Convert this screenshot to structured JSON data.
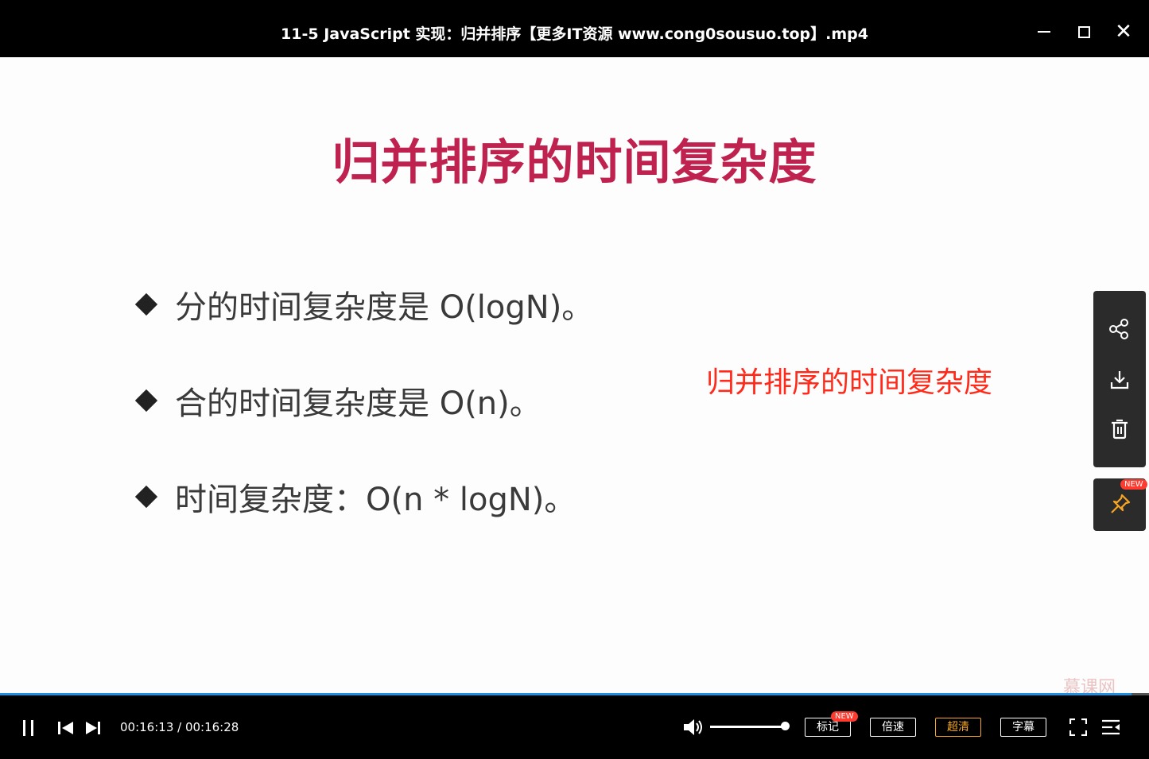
{
  "window": {
    "title": "11-5 JavaScript 实现：归并排序【更多IT资源 www.cong0sousuo.top】.mp4",
    "minimize_icon": "minimize-icon",
    "maximize_icon": "maximize-icon",
    "close_icon": "close-icon",
    "close_glyph": "✕"
  },
  "slide": {
    "title": "归并排序的时间复杂度",
    "bullets": [
      "分的时间复杂度是 O(logN)。",
      "合的时间复杂度是 O(n)。",
      "时间复杂度：O(n * logN)。"
    ]
  },
  "overlay_note": "归并排序的时间复杂度",
  "side_tools": {
    "share_icon": "share-icon",
    "download_icon": "download-icon",
    "delete_icon": "trash-icon",
    "pin_icon": "pin-icon",
    "pin_badge": "NEW"
  },
  "watermark": "慕课网",
  "player": {
    "current_time": "00:16:13",
    "total_time": "00:16:28",
    "time_display": "00:16:13 / 00:16:28",
    "progress_fraction": 0.985,
    "volume_fraction": 0.95,
    "mark_label": "标记",
    "mark_badge": "NEW",
    "speed_label": "倍速",
    "quality_label": "超清",
    "subtitle_label": "字幕",
    "accent_color": "#1e8fe1",
    "quality_color": "#f5a623"
  }
}
